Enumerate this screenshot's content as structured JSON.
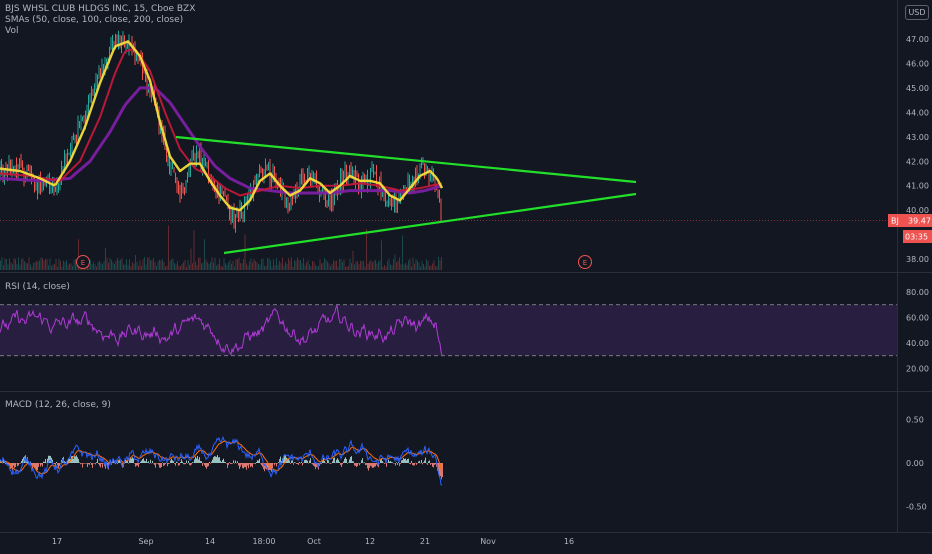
{
  "header": {
    "title": "BJS WHSL CLUB HLDGS INC, 15, Cboe BZX",
    "smas_label": "SMAs (50, close, 100, close, 200, close)",
    "vol_label": "Vol",
    "currency": "USD"
  },
  "colors": {
    "background": "#131722",
    "price_up": "#26a69a",
    "price_down": "#ef5350",
    "sma50": "#f5dd3a",
    "sma100": "#c2183a",
    "sma200": "#7b1fa2",
    "trendline": "#22e02a",
    "rsi_line": "#b03ad6",
    "rsi_band": "#2a1f44",
    "macd_line": "#2962ff",
    "signal_line": "#ff6d00",
    "last_price_badge": "#ef5350"
  },
  "price_badge": {
    "symbol": "BJ",
    "last_price": "39.47",
    "countdown": "03:35"
  },
  "events": [
    "E",
    "E"
  ],
  "chart_data": [
    {
      "type": "line",
      "pane": "price",
      "ylabel": "",
      "ylim": [
        37.6,
        47.8
      ],
      "y_ticks": [
        "47.00",
        "46.00",
        "45.00",
        "44.00",
        "43.00",
        "42.00",
        "41.00",
        "40.00",
        "38.00"
      ],
      "x_ticks": [
        "17",
        "Sep",
        "14",
        "18:00",
        "Oct",
        "12",
        "21",
        "Nov",
        "16"
      ],
      "series": [],
      "price_points": [
        [
          0,
          41.5
        ],
        [
          20,
          41.8
        ],
        [
          40,
          41.0
        ],
        [
          55,
          40.9
        ],
        [
          70,
          42.6
        ],
        [
          85,
          43.9
        ],
        [
          100,
          45.6
        ],
        [
          115,
          46.8
        ],
        [
          125,
          47.0
        ],
        [
          140,
          46.2
        ],
        [
          150,
          45.0
        ],
        [
          160,
          43.6
        ],
        [
          170,
          41.6
        ],
        [
          182,
          40.8
        ],
        [
          195,
          42.4
        ],
        [
          205,
          41.8
        ],
        [
          215,
          40.9
        ],
        [
          225,
          40.3
        ],
        [
          235,
          39.6
        ],
        [
          245,
          40.2
        ],
        [
          255,
          41.0
        ],
        [
          265,
          41.7
        ],
        [
          278,
          41.0
        ],
        [
          290,
          40.2
        ],
        [
          300,
          41.2
        ],
        [
          310,
          41.6
        ],
        [
          320,
          40.8
        ],
        [
          330,
          40.3
        ],
        [
          340,
          41.3
        ],
        [
          350,
          41.6
        ],
        [
          360,
          41.0
        ],
        [
          372,
          41.4
        ],
        [
          382,
          41.0
        ],
        [
          390,
          40.1
        ],
        [
          400,
          40.5
        ],
        [
          410,
          41.3
        ],
        [
          420,
          41.6
        ],
        [
          430,
          41.5
        ],
        [
          437,
          41.0
        ],
        [
          442,
          39.5
        ]
      ],
      "sma50_points": [
        [
          0,
          41.7
        ],
        [
          20,
          41.6
        ],
        [
          40,
          41.3
        ],
        [
          55,
          41.0
        ],
        [
          70,
          42.0
        ],
        [
          85,
          43.4
        ],
        [
          100,
          45.2
        ],
        [
          115,
          46.7
        ],
        [
          128,
          46.9
        ],
        [
          140,
          46.3
        ],
        [
          150,
          45.3
        ],
        [
          160,
          43.6
        ],
        [
          170,
          42.2
        ],
        [
          180,
          41.6
        ],
        [
          190,
          41.9
        ],
        [
          200,
          41.9
        ],
        [
          210,
          41.2
        ],
        [
          220,
          40.6
        ],
        [
          230,
          40.1
        ],
        [
          240,
          40.0
        ],
        [
          250,
          40.4
        ],
        [
          260,
          41.2
        ],
        [
          270,
          41.5
        ],
        [
          280,
          41.0
        ],
        [
          290,
          40.6
        ],
        [
          300,
          40.8
        ],
        [
          310,
          41.3
        ],
        [
          320,
          41.1
        ],
        [
          330,
          40.7
        ],
        [
          340,
          41.0
        ],
        [
          350,
          41.4
        ],
        [
          360,
          41.2
        ],
        [
          370,
          41.2
        ],
        [
          380,
          41.1
        ],
        [
          390,
          40.6
        ],
        [
          400,
          40.4
        ],
        [
          410,
          40.9
        ],
        [
          420,
          41.4
        ],
        [
          430,
          41.6
        ],
        [
          437,
          41.3
        ],
        [
          442,
          40.9
        ]
      ],
      "sma100_points": [
        [
          0,
          41.5
        ],
        [
          30,
          41.4
        ],
        [
          60,
          41.2
        ],
        [
          80,
          42.0
        ],
        [
          100,
          43.8
        ],
        [
          115,
          45.6
        ],
        [
          125,
          46.5
        ],
        [
          135,
          46.6
        ],
        [
          150,
          45.7
        ],
        [
          165,
          44.0
        ],
        [
          180,
          42.5
        ],
        [
          195,
          41.7
        ],
        [
          210,
          41.4
        ],
        [
          225,
          40.9
        ],
        [
          240,
          40.6
        ],
        [
          260,
          40.8
        ],
        [
          280,
          41.0
        ],
        [
          300,
          40.9
        ],
        [
          320,
          41.0
        ],
        [
          340,
          41.0
        ],
        [
          360,
          41.1
        ],
        [
          380,
          41.0
        ],
        [
          400,
          40.8
        ],
        [
          420,
          40.9
        ],
        [
          442,
          41.1
        ]
      ],
      "sma200_points": [
        [
          0,
          41.3
        ],
        [
          40,
          41.2
        ],
        [
          70,
          41.3
        ],
        [
          90,
          42.0
        ],
        [
          110,
          43.2
        ],
        [
          125,
          44.3
        ],
        [
          140,
          45.0
        ],
        [
          155,
          45.0
        ],
        [
          170,
          44.4
        ],
        [
          185,
          43.5
        ],
        [
          200,
          42.6
        ],
        [
          215,
          41.8
        ],
        [
          230,
          41.3
        ],
        [
          250,
          40.9
        ],
        [
          270,
          40.8
        ],
        [
          290,
          40.7
        ],
        [
          310,
          40.7
        ],
        [
          330,
          40.7
        ],
        [
          350,
          40.8
        ],
        [
          370,
          40.8
        ],
        [
          390,
          40.8
        ],
        [
          410,
          40.7
        ],
        [
          425,
          40.8
        ],
        [
          442,
          41.0
        ]
      ]
    },
    {
      "type": "line",
      "pane": "rsi",
      "title": "RSI (14, close)",
      "ylim": [
        12,
        86
      ],
      "y_ticks": [
        "80.00",
        "60.00",
        "40.00",
        "20.00"
      ],
      "band": [
        30,
        70
      ],
      "series": []
    },
    {
      "type": "line",
      "pane": "macd",
      "title": "MACD (12, 26, close, 9)",
      "ylim": [
        -0.6,
        0.63
      ],
      "y_ticks": [
        "0.50",
        "0.00",
        "-0.50"
      ],
      "series": []
    }
  ]
}
